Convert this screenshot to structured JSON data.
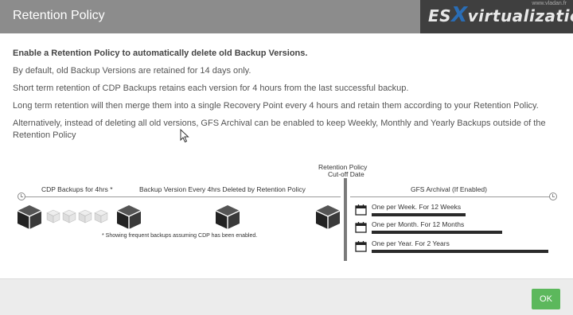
{
  "dialog": {
    "title": "Retention Policy",
    "ok_label": "OK"
  },
  "watermark": {
    "logo_left": "ES",
    "logo_x": "X",
    "logo_right": "virtualization",
    "site": "www.vladan.fr"
  },
  "content": {
    "lead": "Enable a Retention Policy to automatically delete old Backup Versions.",
    "p1": "By default, old Backup Versions are retained for 14 days only.",
    "p2": "Short term retention of CDP Backups retains each version for 4 hours from the last successful backup.",
    "p3": "Long term retention will then merge them into a single Recovery Point every 4 hours and retain them according to your Retention Policy.",
    "p4": "Alternatively, instead of deleting all old versions, GFS Archival can be enabled to keep Weekly, Monthly and Yearly Backups outside of the Retention Policy"
  },
  "diagram": {
    "cutoff_line1": "Retention Policy",
    "cutoff_line2": "Cut-off Date",
    "cdp_label": "CDP Backups for 4hrs *",
    "deleted_label": "Backup Version Every 4hrs Deleted by Retention Policy",
    "gfs_label": "GFS Archival (If Enabled)",
    "footnote": "* Showing frequent backups assuming CDP has been enabled.",
    "gfs_items": [
      {
        "text": "One per Week. For 12 Weeks",
        "fill": 0.53
      },
      {
        "text": "One per Month. For 12 Months",
        "fill": 0.74
      },
      {
        "text": "One per Year. For 2 Years",
        "fill": 1.0
      }
    ]
  }
}
